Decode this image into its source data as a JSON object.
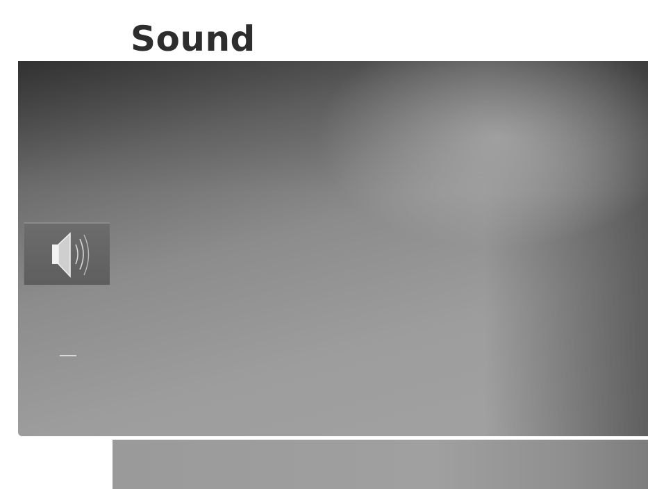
{
  "screen": {
    "title": "Sound"
  },
  "menu": {
    "selected_icon": "speaker-icon",
    "items": [
      {
        "icon": "speaker-icon"
      }
    ]
  },
  "colors": {
    "title_text": "#2d2d2d",
    "panel_dark": "#3c3c3c",
    "panel_light": "#a2a2a2",
    "icon_tile": "#5e5e5e"
  }
}
